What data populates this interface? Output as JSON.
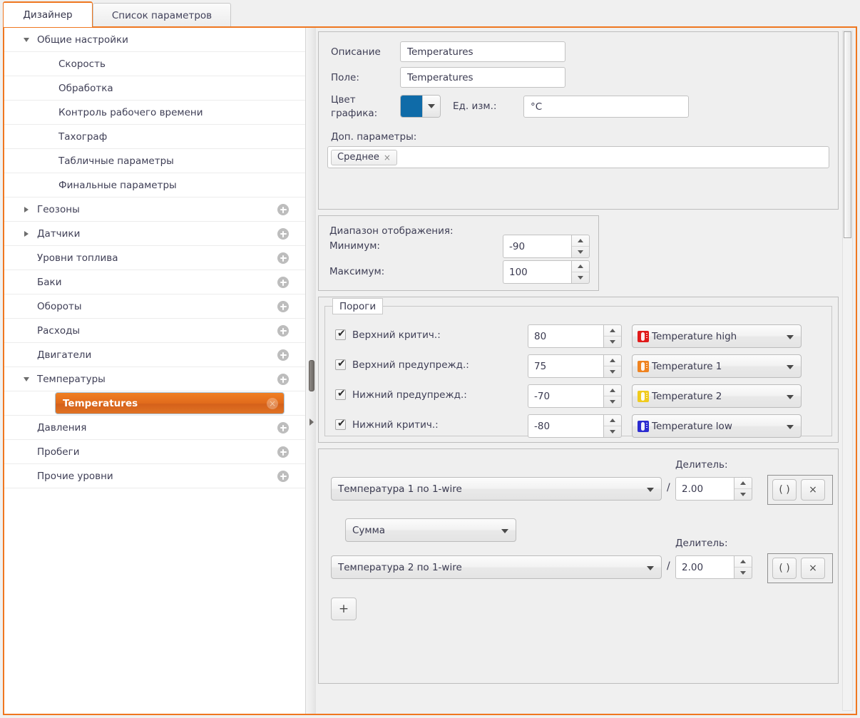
{
  "tabs": [
    {
      "label": "Дизайнер",
      "active": true
    },
    {
      "label": "Список параметров",
      "active": false
    }
  ],
  "tree": {
    "items": [
      {
        "label": "Общие настройки",
        "level": 1,
        "twisty": "down",
        "plus": false
      },
      {
        "label": "Скорость",
        "level": 2,
        "twisty": "none",
        "plus": false
      },
      {
        "label": "Обработка",
        "level": 2,
        "twisty": "none",
        "plus": false
      },
      {
        "label": "Контроль рабочего времени",
        "level": 2,
        "twisty": "none",
        "plus": false
      },
      {
        "label": "Тахограф",
        "level": 2,
        "twisty": "none",
        "plus": false
      },
      {
        "label": "Табличные параметры",
        "level": 2,
        "twisty": "none",
        "plus": false
      },
      {
        "label": "Финальные параметры",
        "level": 2,
        "twisty": "none",
        "plus": false
      },
      {
        "label": "Геозоны",
        "level": 1,
        "twisty": "right",
        "plus": true
      },
      {
        "label": "Датчики",
        "level": 1,
        "twisty": "right",
        "plus": true
      },
      {
        "label": "Уровни топлива",
        "level": 1,
        "twisty": "none",
        "plus": true
      },
      {
        "label": "Баки",
        "level": 1,
        "twisty": "none",
        "plus": true
      },
      {
        "label": "Обороты",
        "level": 1,
        "twisty": "none",
        "plus": true
      },
      {
        "label": "Расходы",
        "level": 1,
        "twisty": "none",
        "plus": true
      },
      {
        "label": "Двигатели",
        "level": 1,
        "twisty": "none",
        "plus": true
      },
      {
        "label": "Температуры",
        "level": 1,
        "twisty": "down",
        "plus": true
      },
      {
        "label": "Temperatures",
        "level": 2,
        "twisty": "none",
        "plus": false,
        "selected": true
      },
      {
        "label": "Давления",
        "level": 1,
        "twisty": "none",
        "plus": true
      },
      {
        "label": "Пробеги",
        "level": 1,
        "twisty": "none",
        "plus": true
      },
      {
        "label": "Прочие уровни",
        "level": 1,
        "twisty": "none",
        "plus": true
      }
    ],
    "selected_close_glyph": "×"
  },
  "general": {
    "description_label": "Описание",
    "description_value": "Temperatures",
    "field_label": "Поле:",
    "field_value": "Temperatures",
    "color_label_line1": "Цвет",
    "color_label_line2": "графика:",
    "color_value": "#0f6ba8",
    "unit_label": "Ед. изм.:",
    "unit_value": "°C",
    "extra_label": "Доп. параметры:",
    "extra_chips": [
      {
        "label": "Среднее",
        "remove": "×"
      }
    ]
  },
  "range": {
    "title": "Диапазон отображения:",
    "min_label": "Минимум:",
    "min_value": "-90",
    "max_label": "Максимум:",
    "max_value": "100"
  },
  "thresholds": {
    "legend": "Пороги",
    "rows": [
      {
        "label": "Верхний критич.:",
        "checked": true,
        "value": "80",
        "preset": "Temperature high",
        "color": "#e01a1a"
      },
      {
        "label": "Верхний предупрежд.:",
        "checked": true,
        "value": "75",
        "preset": "Temperature 1",
        "color": "#ef8320"
      },
      {
        "label": "Нижний предупрежд.:",
        "checked": true,
        "value": "-70",
        "preset": "Temperature 2",
        "color": "#f0cb1e"
      },
      {
        "label": "Нижний критич.:",
        "checked": true,
        "value": "-80",
        "preset": "Temperature low",
        "color": "#2b2bd0"
      }
    ]
  },
  "formula": {
    "divider_label": "Делитель:",
    "slash": "/",
    "operator_value": "Сумма",
    "operands": [
      {
        "source": "Температура 1 по 1-wire",
        "divider": "2.00"
      },
      {
        "source": "Температура 2 по 1-wire",
        "divider": "2.00"
      }
    ],
    "paren_button": "( )",
    "remove_button": "×",
    "add_button": "+"
  }
}
